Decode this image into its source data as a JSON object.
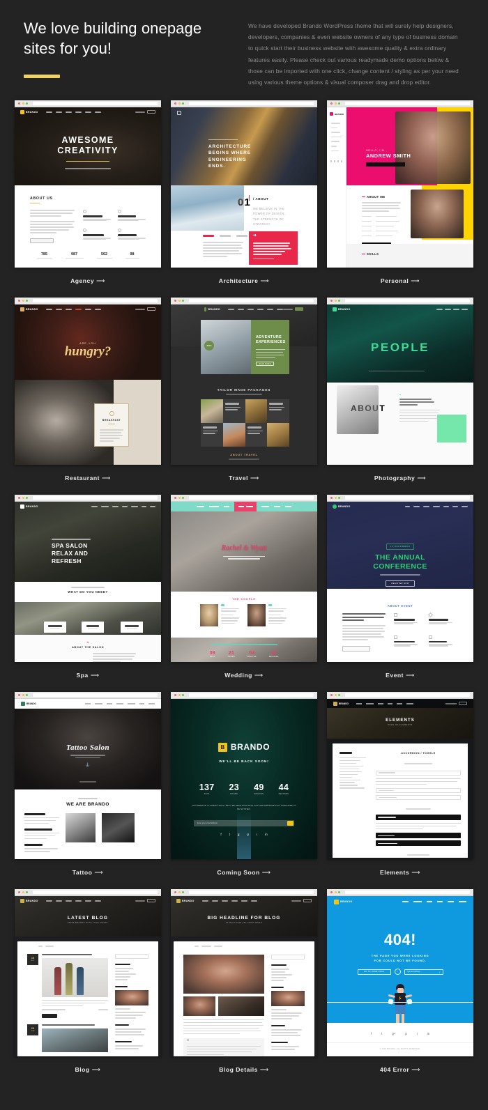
{
  "hero": {
    "title": "We love building onepage sites for you!",
    "paragraph": "We have developed Brando WordPress theme that will surely help designers, developers, companies & even website owners of any type of business domain to quick start their business website with awesome quality & extra ordinary features easily. Please check out various readymade demo options below & those can be imported with one click, change content / styling as per your need using various theme options & visual composer drag and drop editor.",
    "accent_color": "#f0d264"
  },
  "arrow": "⟶",
  "demos": [
    {
      "id": "agency",
      "label": "Agency",
      "headline_line1": "AWESOME",
      "headline_line2": "CREATIVITY",
      "section_title": "ABOUT US",
      "stats": [
        "785",
        "987",
        "562",
        "98"
      ]
    },
    {
      "id": "architecture",
      "label": "Architecture",
      "headline_line1": "ARCHITECTURE",
      "headline_line2": "BEGINS WHERE",
      "headline_line3": "ENGINEERING",
      "headline_line4": "ENDS.",
      "number_badge": "01",
      "section_title": "/ ABOUT",
      "section_body": "WE BELIEVE IN THE POWER OF DESIGN, THE STRENGTH OF STRATEGY.",
      "quote_mark": "“"
    },
    {
      "id": "personal",
      "label": "Personal",
      "eyebrow": "HELLO, I'M",
      "headline": "ANDREW SMITH",
      "section_title": "ABOUT ME",
      "footer_title": "SKILLS",
      "button_label": "DOWNLOAD CV",
      "colors": {
        "pink": "#ec0e6e",
        "yellow": "#ffd400",
        "green": "#1f8a3c"
      }
    },
    {
      "id": "restaurant",
      "label": "Restaurant",
      "eyebrow": "ARE YOU",
      "headline": "hungry?",
      "card_title": "BREAKFAST"
    },
    {
      "id": "travel",
      "label": "Travel",
      "headline_line1": "ADVENTURE",
      "headline_line2": "EXPERIENCES",
      "badge": "SALE",
      "button_label": "READ MORE",
      "section_title": "TAILOR MADE PACKAGES",
      "footer_title": "ABOUT TRAVEL",
      "accent": "#6e8c4a"
    },
    {
      "id": "photography",
      "label": "Photography",
      "headline": "PEOPLE",
      "section_title": "ABOUT",
      "accent": "#3ddc97"
    },
    {
      "id": "spa",
      "label": "Spa",
      "headline_line1": "SPA SALON",
      "headline_line2": "RELAX AND",
      "headline_line3": "REFRESH",
      "section_title": "WHAT DO YOU NEED?",
      "footer_title": "ABOUT THE SALON"
    },
    {
      "id": "wedding",
      "label": "Wedding",
      "headline": "Rachel & Wyatt",
      "section_title": "THE COUPLE",
      "countdown": [
        {
          "value": "39",
          "unit": "DAYS"
        },
        {
          "value": "21",
          "unit": "HOURS"
        },
        {
          "value": "04",
          "unit": "MINUTES"
        },
        {
          "value": "22",
          "unit": "SECONDS"
        }
      ],
      "accent": "#5fd8c4",
      "accent2": "#e8426b"
    },
    {
      "id": "event",
      "label": "Event",
      "eyebrow": "10 DECEMBER",
      "headline_line1": "THE ANNUAL",
      "headline_line2": "CONFERENCE",
      "button_label": "REGISTER NOW",
      "section_title": "ABOUT EVENT",
      "accent": "#2ecc71",
      "bg": "#2a3154"
    },
    {
      "id": "tattoo",
      "label": "Tattoo",
      "headline": "Tattoo Salon",
      "section_title": "WE ARE BRANDO"
    },
    {
      "id": "coming-soon",
      "label": "Coming Soon",
      "brand": "BRANDO",
      "brand_mark": "B",
      "subtitle": "WE'LL BE BACK SOON!",
      "countdown": [
        {
          "value": "137",
          "unit": "DAYS"
        },
        {
          "value": "23",
          "unit": "HOURS"
        },
        {
          "value": "49",
          "unit": "MINUTES"
        },
        {
          "value": "44",
          "unit": "SECONDS"
        }
      ],
      "note": "THIS WEBSITE IS COMING SOON. WE'LL BE HERE SOON WITH OUR NEW AWESOME SITE, SUBSCRIBE TO BE NOTIFIED.",
      "input_placeholder": "Enter your email address",
      "socials": [
        "f",
        "t",
        "g",
        "p",
        "i",
        "in"
      ],
      "accent": "#f0c419"
    },
    {
      "id": "elements",
      "label": "Elements",
      "headline": "ELEMENTS",
      "subtitle": "PAGE OF ELEMENTS",
      "sidebar_title": "ELEMENTS",
      "section_title": "ACCORDION / TOGGLE"
    },
    {
      "id": "blog",
      "label": "Blog",
      "headline": "LATEST BLOG",
      "subtitle": "FROM BRANDO WITH LOVE INSIDE",
      "date_badge_1_day": "15",
      "date_badge_1_month": "JULY",
      "date_badge_2_day": "26",
      "date_badge_2_month": "JUNE",
      "button_label": "READ MORE"
    },
    {
      "id": "blog-details",
      "label": "Blog Details",
      "headline": "BIG HEADLINE FOR BLOG",
      "subtitle": "15 March 2018  |  BY CHRIS SMITH",
      "quote_mark": "“"
    },
    {
      "id": "404-error",
      "label": "404 Error",
      "brand": "BRANDO",
      "headline": "404!",
      "message_line1": "THE PAGE YOU WERE LOOKING",
      "message_line2": "FOR COULD NOT BE FOUND.",
      "button_label": "GO TO HOME PAGE",
      "search_placeholder": "Type something...",
      "socials": [
        "f",
        "t",
        "g+",
        "p",
        "i",
        "in"
      ],
      "footer_text": "© 2018 BRANDO. ALL RIGHTS RESERVED.",
      "bg": "#0f9ae0"
    }
  ]
}
